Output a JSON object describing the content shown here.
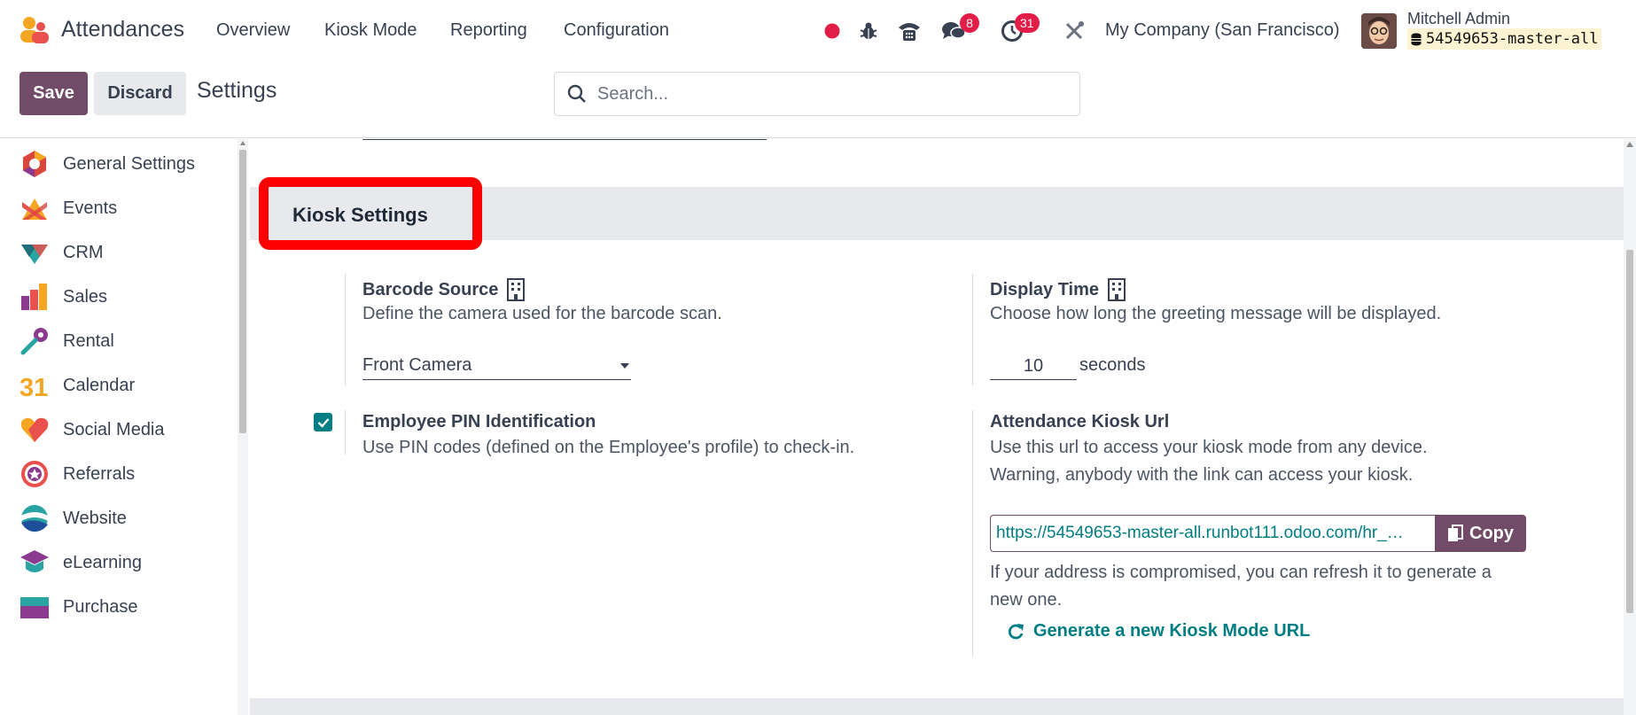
{
  "app": {
    "name": "Attendances",
    "logo_icon": "attendances-logo-icon"
  },
  "menu": [
    {
      "label": "Overview"
    },
    {
      "label": "Kiosk Mode"
    },
    {
      "label": "Reporting"
    },
    {
      "label": "Configuration"
    }
  ],
  "systray": {
    "messages_count": "8",
    "activities_count": "31",
    "company": "My Company (San Francisco)",
    "user_name": "Mitchell Admin",
    "database": "54549653-master-all"
  },
  "control": {
    "save_label": "Save",
    "discard_label": "Discard",
    "breadcrumb": "Settings",
    "search_placeholder": "Search..."
  },
  "sidebar": {
    "items": [
      {
        "label": "General Settings",
        "icon": "general-settings-icon"
      },
      {
        "label": "Events",
        "icon": "events-icon"
      },
      {
        "label": "CRM",
        "icon": "crm-icon"
      },
      {
        "label": "Sales",
        "icon": "sales-icon"
      },
      {
        "label": "Rental",
        "icon": "rental-icon"
      },
      {
        "label": "Calendar",
        "icon": "calendar-icon"
      },
      {
        "label": "Social Media",
        "icon": "social-media-icon"
      },
      {
        "label": "Referrals",
        "icon": "referrals-icon"
      },
      {
        "label": "Website",
        "icon": "website-icon"
      },
      {
        "label": "eLearning",
        "icon": "elearning-icon"
      },
      {
        "label": "Purchase",
        "icon": "purchase-icon"
      }
    ]
  },
  "calendar_icon_text": "31",
  "kiosk": {
    "section_title": "Kiosk Settings",
    "barcode": {
      "title": "Barcode Source",
      "description": "Define the camera used for the barcode scan.",
      "value": "Front Camera"
    },
    "display_time": {
      "title": "Display Time",
      "description": "Choose how long the greeting message will be displayed.",
      "value": "10",
      "unit": "seconds"
    },
    "pin": {
      "title": "Employee PIN Identification",
      "description": "Use PIN codes (defined on the Employee's profile) to check-in.",
      "checked": true
    },
    "url": {
      "title": "Attendance Kiosk Url",
      "description_1": "Use this url to access your kiosk mode from any device.",
      "description_2": "Warning, anybody with the link can access your kiosk.",
      "value": "https://54549653-master-all.runbot111.odoo.com/hr_…",
      "copy_label": "Copy",
      "refresh_note_1": "If your address is compromised, you can refresh it to generate a",
      "refresh_note_2": "new one.",
      "generate_label": "Generate a new Kiosk Mode URL"
    }
  },
  "colors": {
    "brand": "#714b67",
    "teal": "#017e84",
    "highlight": "#ff0000",
    "badge": "#e11d48"
  }
}
